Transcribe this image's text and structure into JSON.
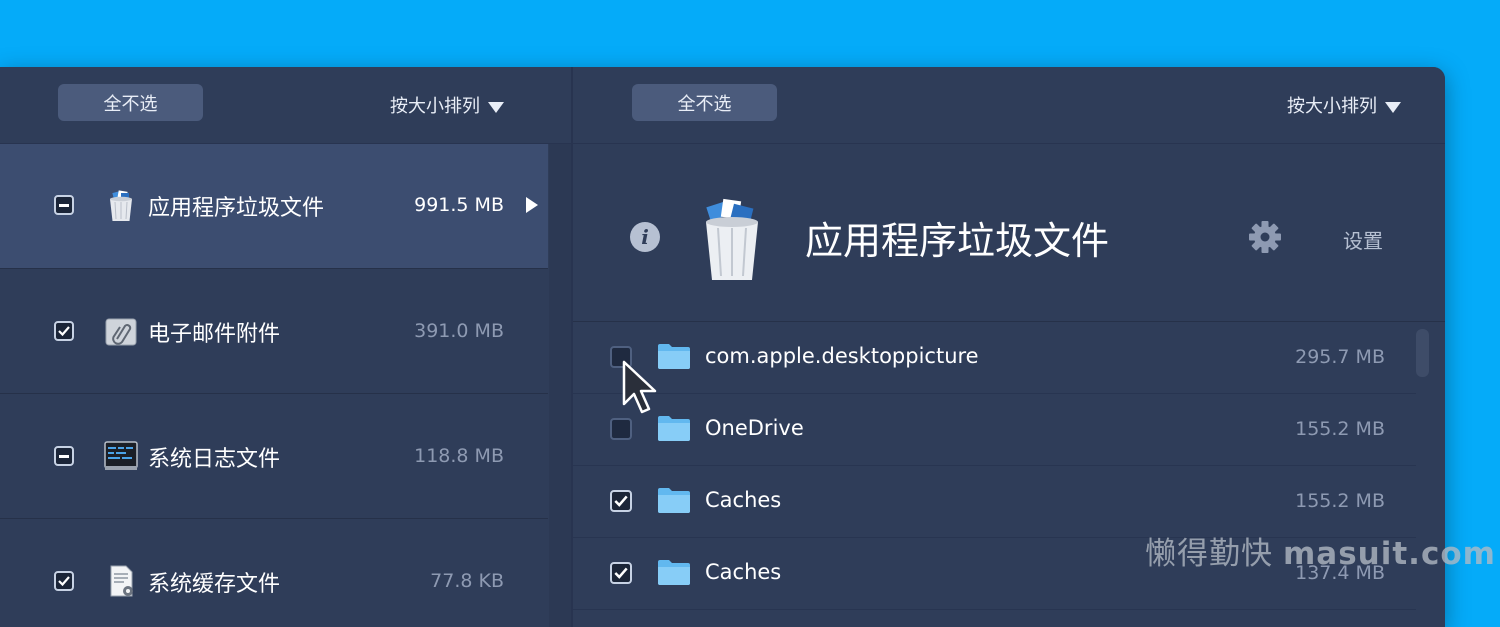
{
  "left_toolbar": {
    "deselect_label": "全不选",
    "sort_label": "按大小排列"
  },
  "right_toolbar": {
    "deselect_label": "全不选",
    "sort_label": "按大小排列"
  },
  "categories": [
    {
      "label": "应用程序垃圾文件",
      "size": "991.5 MB",
      "state": "mixed",
      "icon": "trash-bin-icon",
      "selected": true
    },
    {
      "label": "电子邮件附件",
      "size": "391.0 MB",
      "state": "checked",
      "icon": "paperclip-icon",
      "selected": false
    },
    {
      "label": "系统日志文件",
      "size": "118.8 MB",
      "state": "mixed",
      "icon": "console-log-icon",
      "selected": false
    },
    {
      "label": "系统缓存文件",
      "size": "77.8 KB",
      "state": "checked",
      "icon": "document-gear-icon",
      "selected": false
    }
  ],
  "detail": {
    "title": "应用程序垃圾文件",
    "settings_label": "设置",
    "icons": [
      "info-icon",
      "trash-bin-icon",
      "gear-icon"
    ]
  },
  "files": [
    {
      "name": "com.apple.desktoppicture",
      "size": "295.7 MB",
      "checked": false
    },
    {
      "name": "OneDrive",
      "size": "155.2 MB",
      "checked": false
    },
    {
      "name": "Caches",
      "size": "155.2 MB",
      "checked": true
    },
    {
      "name": "Caches",
      "size": "137.4 MB",
      "checked": true
    }
  ],
  "watermark": {
    "cn": "懒得勤快",
    "en": "masuit.com"
  },
  "colors": {
    "background": "#05abf9",
    "window": "#2f3d59",
    "selected_row": "#3c4d70",
    "button": "#4b5b7c",
    "dim_text": "#8e9ab2"
  }
}
